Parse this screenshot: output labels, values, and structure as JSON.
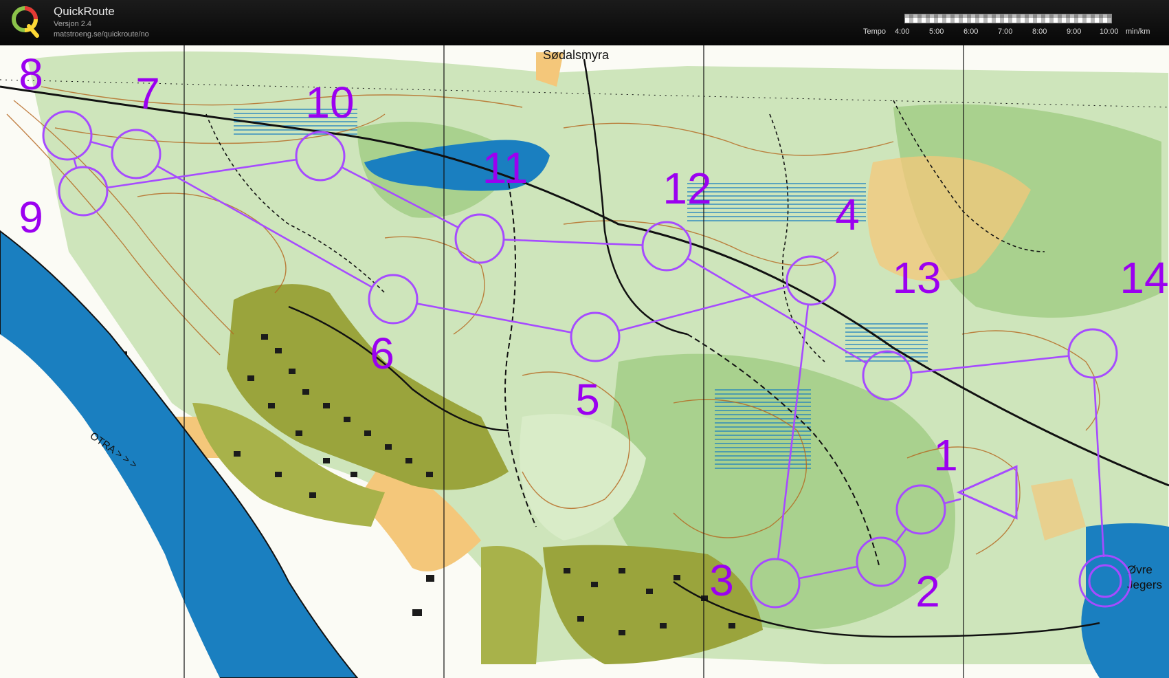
{
  "app": {
    "title": "QuickRoute",
    "version": "Versjon 2.4",
    "url": "matstroeng.se/quickroute/no"
  },
  "pace_legend": {
    "label": "Tempo",
    "ticks": [
      "4:00",
      "5:00",
      "6:00",
      "7:00",
      "8:00",
      "9:00",
      "10:00"
    ],
    "unit": "min/km"
  },
  "map": {
    "place_names": {
      "sodalsmyra": "Sødalsmyra",
      "ovre_jegers_1": "Øvre",
      "ovre_jegers_2": "Jegers",
      "river": "OTRA > > >"
    },
    "controls": [
      {
        "label": "1"
      },
      {
        "label": "2"
      },
      {
        "label": "3"
      },
      {
        "label": "4"
      },
      {
        "label": "5"
      },
      {
        "label": "6"
      },
      {
        "label": "7"
      },
      {
        "label": "8"
      },
      {
        "label": "9"
      },
      {
        "label": "10"
      },
      {
        "label": "11"
      },
      {
        "label": "12"
      },
      {
        "label": "13"
      },
      {
        "label": "14"
      }
    ],
    "colors": {
      "course": "#a64bff",
      "course_numbers": "#9b00f0",
      "water": "#1a7fc0",
      "forest_light": "#c5e0b0",
      "forest_green": "#8cbf6c",
      "open_yellow": "#f4c77a",
      "urban_olive": "#9aa43c",
      "paper": "#fbfbf5"
    },
    "icons": {
      "start": "triangle",
      "finish": "double-circle",
      "control": "circle"
    }
  }
}
